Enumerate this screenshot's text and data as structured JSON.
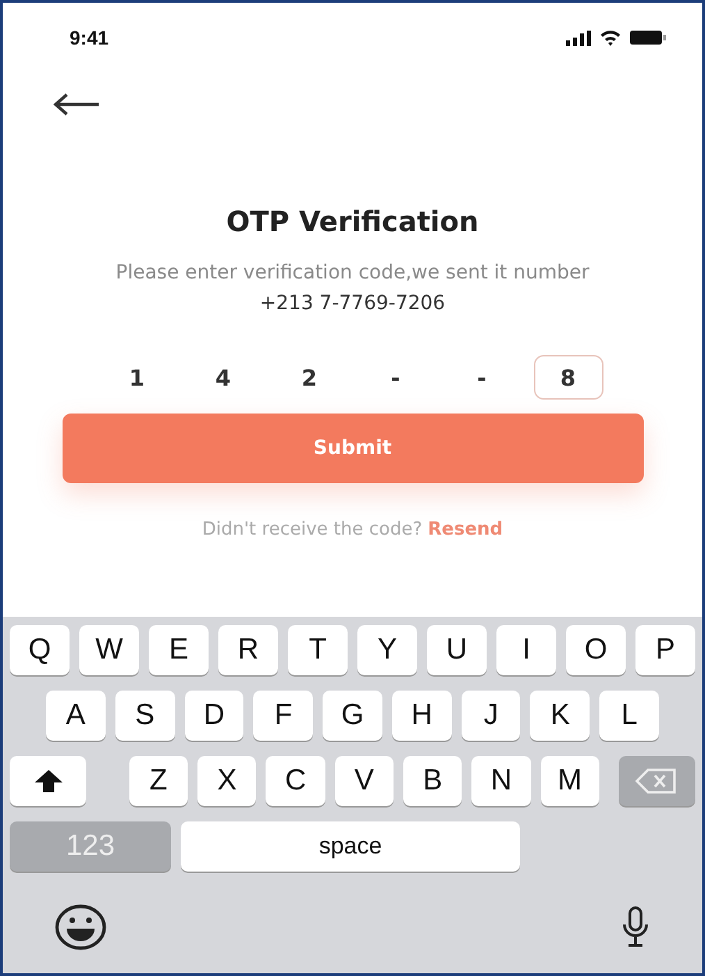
{
  "status_bar": {
    "time": "9:41"
  },
  "title": "OTP Verification",
  "subtitle": "Please enter verification code,we sent it number **+213 7-7769-7206**",
  "otp": [
    {
      "value": "1",
      "selected": false
    },
    {
      "value": "4",
      "selected": false
    },
    {
      "value": "2",
      "selected": false
    },
    {
      "value": "-",
      "selected": false
    },
    {
      "value": "-",
      "selected": false
    },
    {
      "value": "8",
      "selected": true
    }
  ],
  "submit_button": "Submit",
  "resend": {
    "prompt": "Didn't receive the code?",
    "link": "Resend"
  },
  "keyboard": {
    "rows": [
      [
        "Q",
        "W",
        "E",
        "R",
        "T",
        "Y",
        "U",
        "I",
        "O",
        "P"
      ],
      [
        "A",
        "S",
        "D",
        "F",
        "G",
        "H",
        "J",
        "K",
        "L"
      ],
      [
        "Z",
        "X",
        "C",
        "V",
        "B",
        "N",
        "M"
      ]
    ],
    "numbers_key": "123",
    "space_key": "space"
  }
}
